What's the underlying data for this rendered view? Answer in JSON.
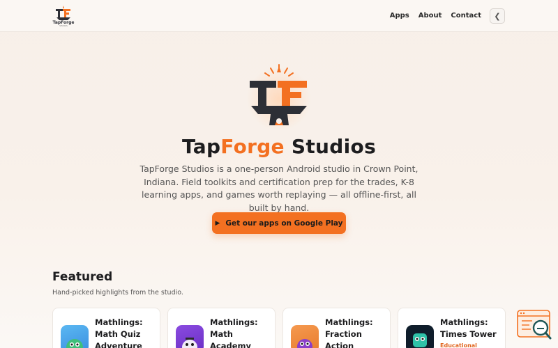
{
  "header": {
    "logo_text": "TapForge",
    "logo_subtext": "STUDIOS",
    "nav": [
      {
        "label": "Apps"
      },
      {
        "label": "About"
      },
      {
        "label": "Contact"
      }
    ],
    "theme_toggle_glyph": "❮"
  },
  "hero": {
    "title_part1": "Tap",
    "title_part2": "Forge",
    "title_part3": " Studios",
    "description": "TapForge Studios is a one-person Android studio in Crown Point, Indiana. Field toolkits and certification prep for the trades, K-8 learning apps, and games worth replaying — all offline-first, all built by hand.",
    "cta_label": "Get our apps on Google Play",
    "cta_icon": "▶"
  },
  "featured": {
    "title": "Featured",
    "subtitle": "Hand-picked highlights from the studio.",
    "cards": [
      {
        "title": "Mathlings:\nMath Quiz\nAdventure",
        "tag": "",
        "icon": "mathlings-green-mascot",
        "icon_color": "#4aa3e8"
      },
      {
        "title": "Mathlings:\nMath\nAcademy",
        "tag": "",
        "icon": "mathlings-purple-mascot",
        "icon_color": "#7b3fd1"
      },
      {
        "title": "Mathlings:\nFraction\nAction",
        "tag": "",
        "icon": "mathlings-orange-mascot",
        "icon_color": "#f08a3c"
      },
      {
        "title": "Mathlings:\nTimes Tower",
        "tag": "Educational",
        "icon": "mathlings-teal-mascot",
        "icon_color": "#0d1b2a"
      }
    ]
  },
  "colors": {
    "accent": "#f37021",
    "dark": "#1d1d1f"
  }
}
